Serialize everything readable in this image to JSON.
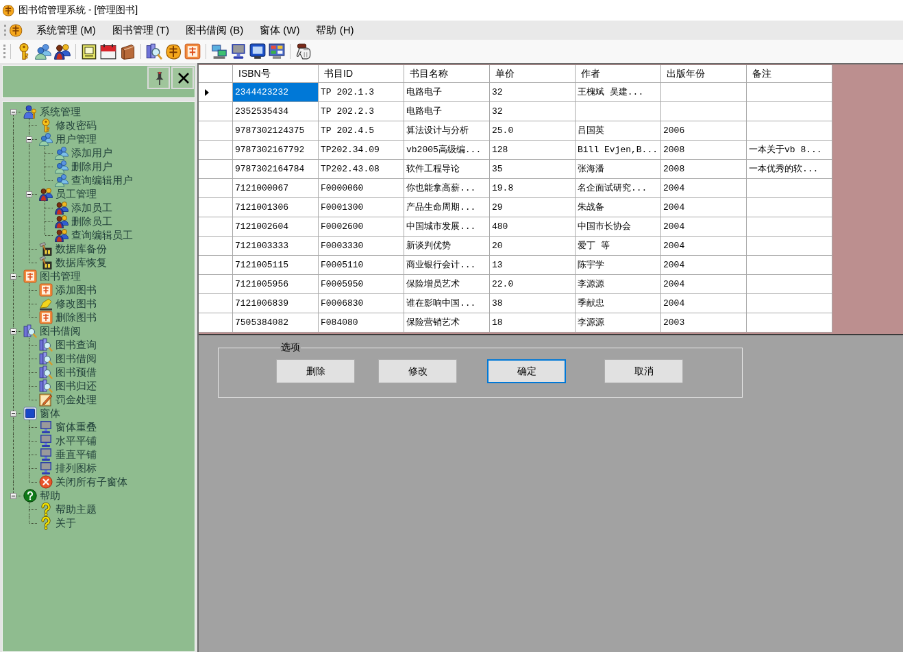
{
  "window": {
    "title": "图书馆管理系统 - [管理图书]"
  },
  "menu": [
    "系统管理 (M)",
    "图书管理 (T)",
    "图书借阅 (B)",
    "窗体 (W)",
    "帮助 (H)"
  ],
  "tree": [
    {
      "label": "系统管理",
      "kind": "admin",
      "expanded": true,
      "children": [
        {
          "label": "修改密码",
          "kind": "key"
        },
        {
          "label": "用户管理",
          "kind": "users",
          "expanded": true,
          "children": [
            {
              "label": "添加用户",
              "kind": "users"
            },
            {
              "label": "删除用户",
              "kind": "users"
            },
            {
              "label": "查询编辑用户",
              "kind": "users"
            }
          ]
        },
        {
          "label": "员工管理",
          "kind": "staff",
          "expanded": true,
          "children": [
            {
              "label": "添加员工",
              "kind": "staff"
            },
            {
              "label": "删除员工",
              "kind": "staff"
            },
            {
              "label": "查询编辑员工",
              "kind": "staff"
            }
          ]
        },
        {
          "label": "数据库备份",
          "kind": "toolbox"
        },
        {
          "label": "数据库恢复",
          "kind": "toolbox"
        }
      ]
    },
    {
      "label": "图书管理",
      "kind": "book",
      "expanded": true,
      "children": [
        {
          "label": "添加图书",
          "kind": "book"
        },
        {
          "label": "修改图书",
          "kind": "pen"
        },
        {
          "label": "删除图书",
          "kind": "book"
        }
      ]
    },
    {
      "label": "图书借阅",
      "kind": "search",
      "expanded": true,
      "children": [
        {
          "label": "图书查询",
          "kind": "search"
        },
        {
          "label": "图书借阅",
          "kind": "search"
        },
        {
          "label": "图书预借",
          "kind": "search"
        },
        {
          "label": "图书归还",
          "kind": "search"
        },
        {
          "label": "罚金处理",
          "kind": "notepad"
        }
      ]
    },
    {
      "label": "窗体",
      "kind": "window",
      "expanded": true,
      "children": [
        {
          "label": "窗体重叠",
          "kind": "monitor"
        },
        {
          "label": "水平平铺",
          "kind": "monitor"
        },
        {
          "label": "垂直平铺",
          "kind": "monitor"
        },
        {
          "label": "排列图标",
          "kind": "monitor"
        },
        {
          "label": "关闭所有子窗体",
          "kind": "close"
        }
      ]
    },
    {
      "label": "帮助",
      "kind": "help",
      "expanded": true,
      "children": [
        {
          "label": "帮助主题",
          "kind": "question"
        },
        {
          "label": "关于",
          "kind": "question"
        }
      ]
    }
  ],
  "table": {
    "columns": [
      "ISBN号",
      "书目ID",
      "书目名称",
      "单价",
      "作者",
      "出版年份",
      "备注"
    ],
    "rows": [
      {
        "selected": true,
        "isbn": "2344423232",
        "book_id": "TP 202.1.3",
        "title": "电路电子",
        "price": "32",
        "author": "王槐斌 吴建..."
      },
      {
        "selected": false,
        "isbn": "2352535434",
        "book_id": "TP 202.2.3",
        "title": "电路电子",
        "price": "32"
      },
      {
        "selected": false,
        "isbn": "9787302124375",
        "book_id": "TP 202.4.5",
        "title": "算法设计与分析",
        "price": "25.0",
        "author": "吕国英",
        "year": "2006"
      },
      {
        "selected": false,
        "isbn": "9787302167792",
        "book_id": "TP202.34.09",
        "title": "vb2005高级编...",
        "price": "128",
        "author": "Bill Evjen,B...",
        "year": "2008",
        "note": "一本关于vb 8..."
      },
      {
        "selected": false,
        "isbn": "9787302164784",
        "book_id": "TP202.43.08",
        "title": "软件工程导论",
        "price": "35",
        "author": "张海潘",
        "year": "2008",
        "note": "一本优秀的软..."
      },
      {
        "selected": false,
        "isbn": "7121000067",
        "book_id": "F0000060",
        "title": "你也能拿高薪...",
        "price": "19.8",
        "author": "名企面试研究...",
        "year": "2004"
      },
      {
        "selected": false,
        "isbn": "7121001306",
        "book_id": "F0001300",
        "title": "产品生命周期...",
        "price": "29",
        "author": "朱战备",
        "year": "2004"
      },
      {
        "selected": false,
        "isbn": "7121002604",
        "book_id": "F0002600",
        "title": "中国城市发展...",
        "price": "480",
        "author": "中国市长协会",
        "year": "2004"
      },
      {
        "selected": false,
        "isbn": "7121003333",
        "book_id": "F0003330",
        "title": "新谈判优势",
        "price": "20",
        "author": "爱丁 等",
        "year": "2004"
      },
      {
        "selected": false,
        "isbn": "7121005115",
        "book_id": "F0005110",
        "title": "商业银行会计...",
        "price": "13",
        "author": "陈宇学",
        "year": "2004"
      },
      {
        "selected": false,
        "isbn": "7121005956",
        "book_id": "F0005950",
        "title": "保险增员艺术",
        "price": "22.0",
        "author": "李源源",
        "year": "2004"
      },
      {
        "selected": false,
        "isbn": "7121006839",
        "book_id": "F0006830",
        "title": "谁在影响中国...",
        "price": "38",
        "author": "季献忠",
        "year": "2004"
      },
      {
        "selected": false,
        "isbn": "7505384082",
        "book_id": "F084080",
        "title": "保险营销艺术",
        "price": "18",
        "author": "李源源",
        "year": "2003"
      }
    ]
  },
  "options": {
    "title": "选项",
    "buttons": [
      {
        "label": "删除",
        "focused": false
      },
      {
        "label": "修改",
        "focused": false
      },
      {
        "label": "确定",
        "focused": true
      },
      {
        "label": "取消",
        "focused": false
      }
    ]
  }
}
